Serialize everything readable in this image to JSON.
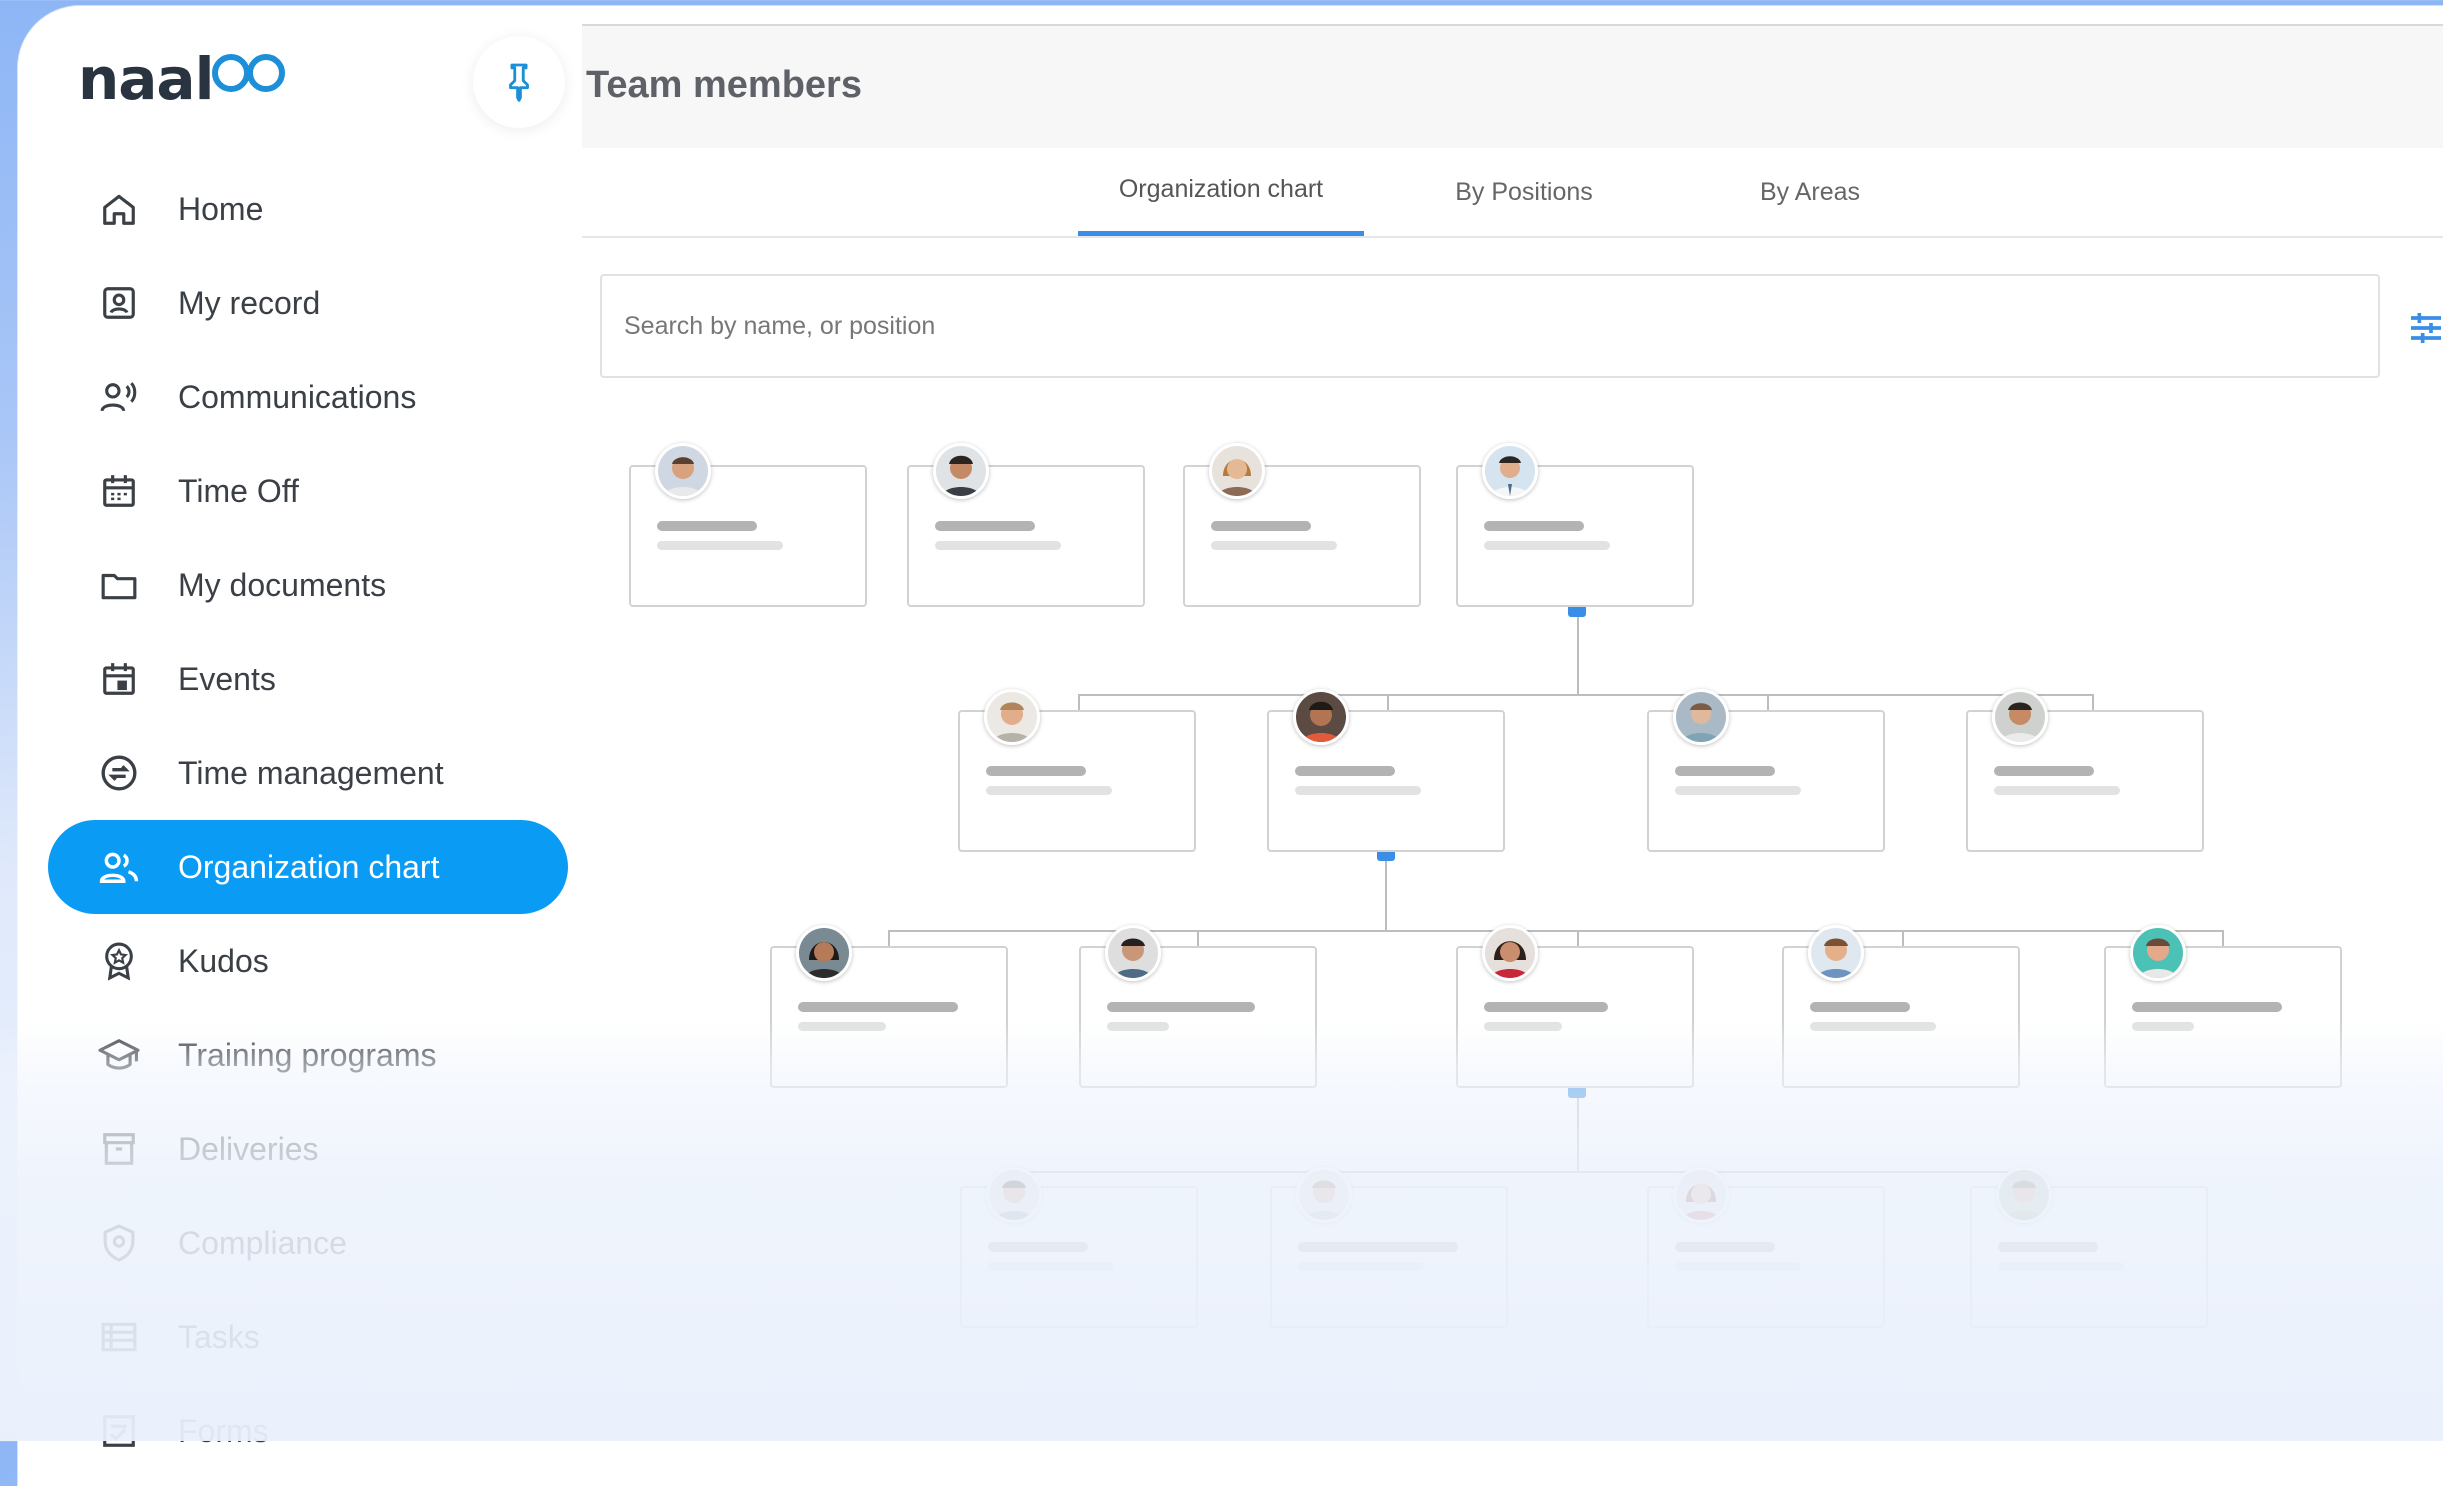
{
  "brand": {
    "logo_text": "naal",
    "accent": "#0a9cf5"
  },
  "header": {
    "title": "Team members"
  },
  "sidebar": {
    "items": [
      {
        "label": "Home",
        "icon": "home-icon"
      },
      {
        "label": "My record",
        "icon": "id-card-icon"
      },
      {
        "label": "Communications",
        "icon": "speaking-person-icon"
      },
      {
        "label": "Time Off",
        "icon": "calendar-icon"
      },
      {
        "label": "My documents",
        "icon": "folder-icon"
      },
      {
        "label": "Events",
        "icon": "calendar-event-icon"
      },
      {
        "label": "Time management",
        "icon": "clock-arrows-icon"
      },
      {
        "label": "Organization chart",
        "icon": "people-icon",
        "active": true
      },
      {
        "label": "Kudos",
        "icon": "award-badge-icon"
      },
      {
        "label": "Training programs",
        "icon": "graduation-cap-icon"
      },
      {
        "label": "Deliveries",
        "icon": "archive-box-icon"
      },
      {
        "label": "Compliance",
        "icon": "shield-icon"
      },
      {
        "label": "Tasks",
        "icon": "list-icon"
      },
      {
        "label": "Forms",
        "icon": "form-icon"
      }
    ]
  },
  "tabs": [
    {
      "label": "Organization chart",
      "active": true
    },
    {
      "label": "By Positions"
    },
    {
      "label": "By Areas"
    }
  ],
  "search": {
    "placeholder": "Search by name, or position"
  }
}
